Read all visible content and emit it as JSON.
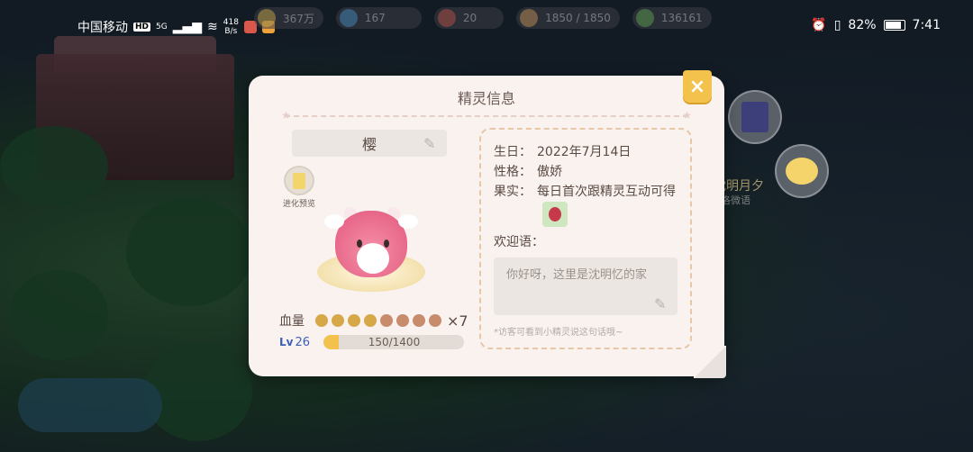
{
  "status_bar": {
    "carrier": "中国移动",
    "hd": "HD",
    "network": "5G",
    "speed_value": "418",
    "speed_unit": "B/s",
    "battery": "82%",
    "time": "7:41"
  },
  "resources": [
    {
      "value": "367万",
      "icon": "coin-icon"
    },
    {
      "value": "167",
      "icon": "star-icon"
    },
    {
      "value": "20",
      "icon": "mushroom-icon"
    },
    {
      "value": "1850 / 1850",
      "icon": "pet-face-icon"
    },
    {
      "value": "136161",
      "icon": "clover-icon"
    }
  ],
  "neighbor": {
    "name": "沈明月夕",
    "sub": "洛微语"
  },
  "dialog": {
    "title": "精灵信息",
    "close": "×",
    "pet_name": "樱",
    "evolve_label": "进化预览",
    "hp_label": "血量",
    "hp_units": 8,
    "hp_multiplier": "×7",
    "level_badge": "Lv",
    "level": "26",
    "exp_text": "150/1400",
    "exp_fraction": 0.107,
    "info": {
      "birthday_key": "生日：",
      "birthday_value": "2022年7月14日",
      "personality_key": "性格：",
      "personality_value": "傲娇",
      "fruit_key": "果实：",
      "fruit_value": "每日首次跟精灵互动可得"
    },
    "welcome_label": "欢迎语：",
    "welcome_text": "你好呀，这里是沈明忆的家",
    "hint": "*访客可看到小精灵说这句话哦~"
  },
  "colors": {
    "dialog_bg": "#f9f2ef",
    "accent_gold": "#f2c24c",
    "level_blue": "#3b5fb8"
  }
}
